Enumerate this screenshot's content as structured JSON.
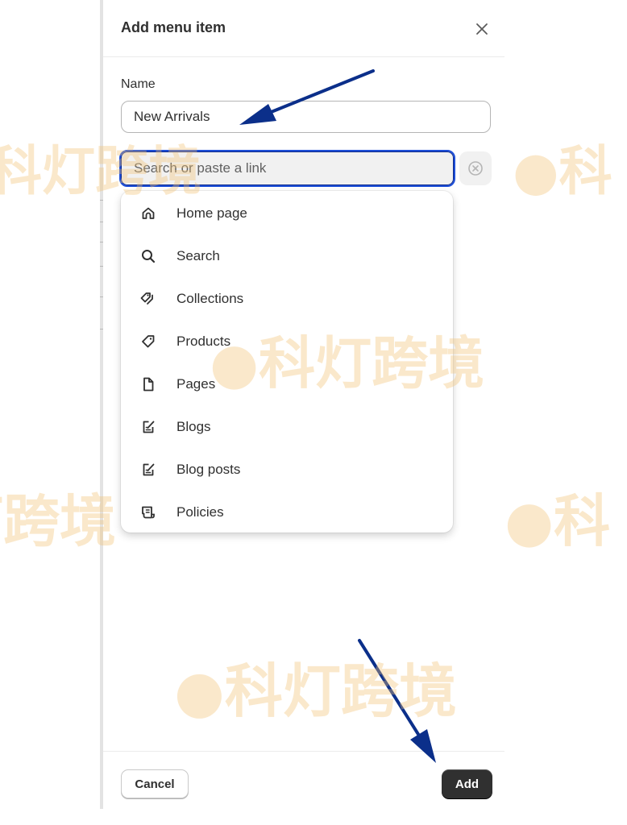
{
  "modal": {
    "title": "Add menu item",
    "close_icon": "close-icon"
  },
  "name_field": {
    "label": "Name",
    "value": "New Arrivals"
  },
  "link_field": {
    "value": "",
    "placeholder": "Search or paste a link",
    "clear_icon": "clear-circle-icon",
    "accent_color": "#1d4ed8"
  },
  "dropdown": {
    "items": [
      {
        "label": "Home page",
        "icon": "home-icon"
      },
      {
        "label": "Search",
        "icon": "search-icon"
      },
      {
        "label": "Collections",
        "icon": "collections-icon"
      },
      {
        "label": "Products",
        "icon": "tag-icon"
      },
      {
        "label": "Pages",
        "icon": "page-icon"
      },
      {
        "label": "Blogs",
        "icon": "blog-icon"
      },
      {
        "label": "Blog posts",
        "icon": "blog-post-icon"
      },
      {
        "label": "Policies",
        "icon": "policy-icon"
      }
    ]
  },
  "footer": {
    "cancel_label": "Cancel",
    "add_label": "Add",
    "add_color": "#303030"
  },
  "annotations": {
    "arrow_color": "#0b2f8a"
  },
  "watermark": {
    "text": "科灯跨境",
    "color": "#f0be6e"
  }
}
